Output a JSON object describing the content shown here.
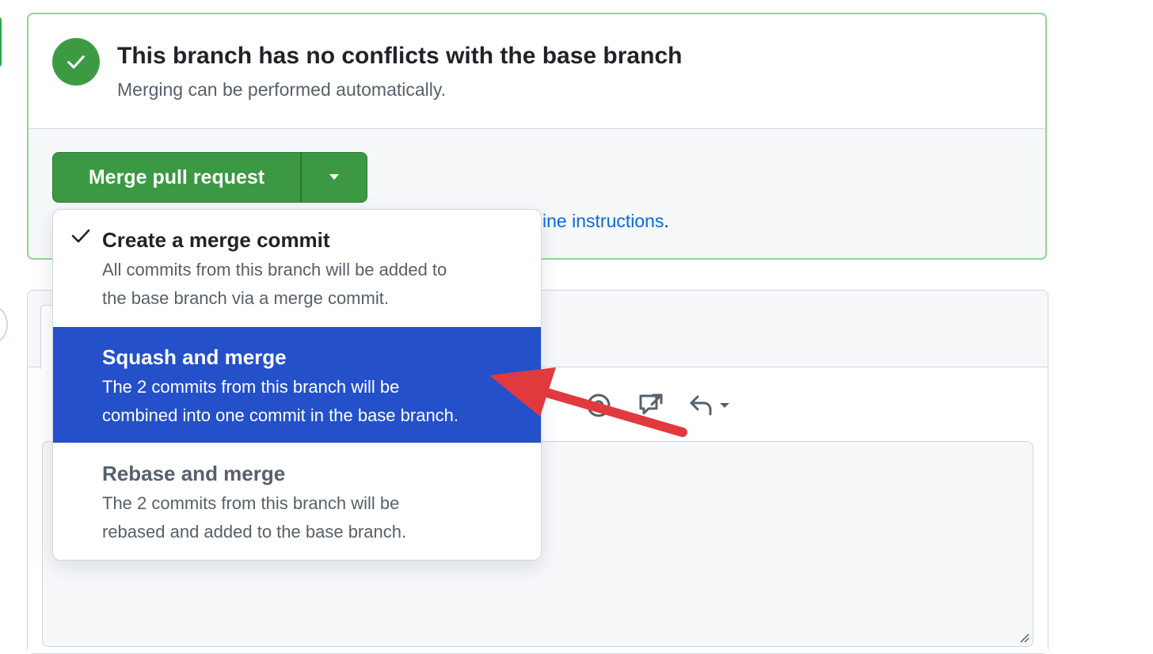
{
  "merge_status": {
    "title": "This branch has no conflicts with the base branch",
    "subtitle": "Merging can be performed automatically.",
    "icon": "check-circle-icon",
    "color": "#3c9a43"
  },
  "merge_button": {
    "label": "Merge pull request",
    "caret_icon": "triangle-down-icon",
    "color": "#3b9843"
  },
  "cli_hint": {
    "visible_link_text": "mand line instructions",
    "suffix": "."
  },
  "merge_options": [
    {
      "title": "Create a merge commit",
      "desc_line1": "All commits from this branch will be added to",
      "desc_line2": "the base branch via a merge commit.",
      "checked": true
    },
    {
      "title": "Squash and merge",
      "desc_line1": "The 2 commits from this branch will be",
      "desc_line2": "combined into one commit in the base branch.",
      "highlighted": true,
      "highlight_color": "#2450c9"
    },
    {
      "title": "Rebase and merge",
      "desc_line1": "The 2 commits from this branch will be",
      "desc_line2": "rebased and added to the base branch."
    }
  ],
  "comment_toolbar": {
    "icons": [
      "mention-icon",
      "cross-reference-icon",
      "reply-icon"
    ]
  },
  "annotation": {
    "type": "red-arrow",
    "color": "#e03a3e",
    "points_to": "Squash and merge"
  }
}
